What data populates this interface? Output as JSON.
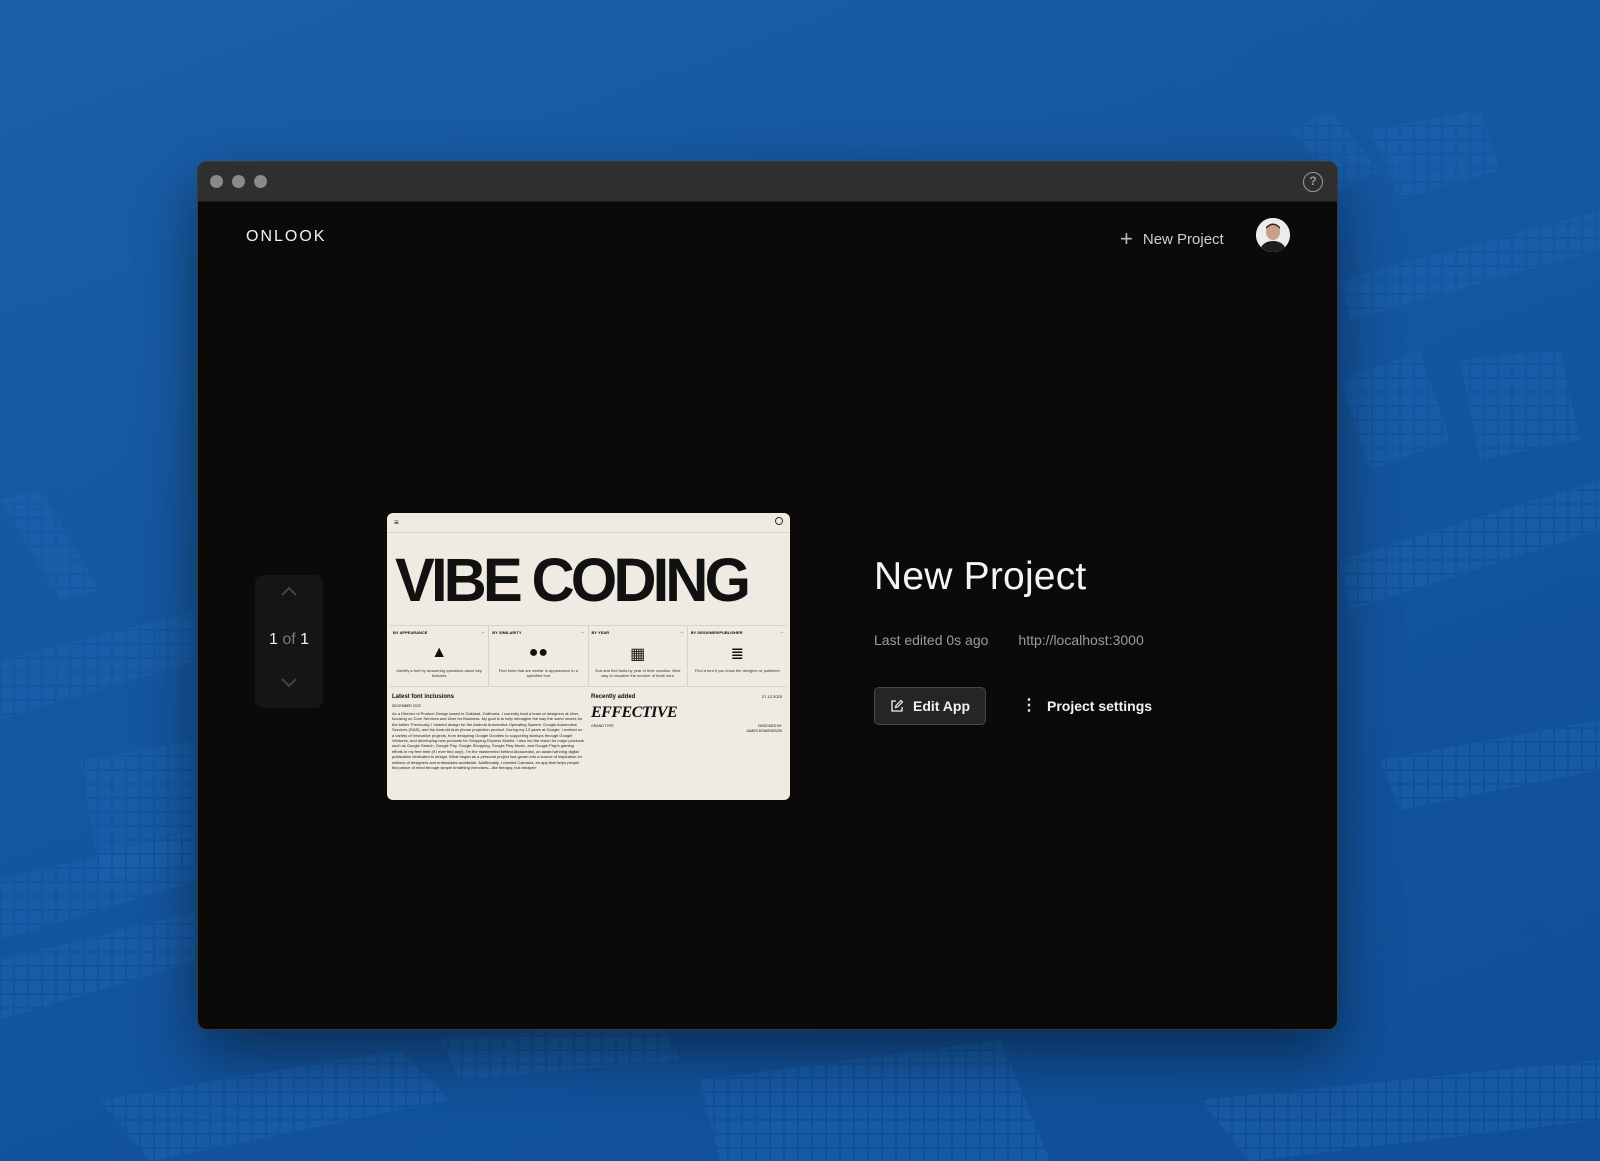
{
  "window": {
    "help_icon": "?"
  },
  "header": {
    "logo": "ONLOOK",
    "new_project_icon": "+",
    "new_project_label": "New Project"
  },
  "pager": {
    "current": "1",
    "of": "of",
    "total": "1"
  },
  "preview": {
    "menu_icon": "≡",
    "headline": "VIBE CODING",
    "categories": [
      {
        "label": "BY APPEARANCE",
        "glyph": "▲",
        "desc": "Identify a font by answering questions about key features"
      },
      {
        "label": "BY SIMILARITY",
        "glyph": "●●",
        "desc": "Find fonts that are similar in appearance to a specified font"
      },
      {
        "label": "BY YEAR",
        "glyph": "▦",
        "desc": "Sort and find fonts by year of their creation. Best way to visualize the number of fonts here"
      },
      {
        "label": "BY DESIGNER/PUBLISHER",
        "glyph": "≣",
        "desc": "Find a font if you know the designer or publisher"
      }
    ],
    "arrow": "→",
    "latest_title": "Latest font inclusions",
    "latest_date": "DECEMBER 2023",
    "latest_body": "As a Director of Product Design based in Oakland, California, I currently lead a team of designers at Uber, focusing on Core Services and Uber for Business. My goal is to help reimagine the way the world moves for the better. Previously, I headed design for the Android Automotive Operating System, Google Automotive Services (GAS), and the Android Auto phone projection product. During my 13 years at Google, I worked on a variety of innovative projects, from designing Google Doodles to supporting startups through Google Ventures, and developing new products for Shopping Express Mobile. I also led the vision for major products such as Google Search, Google Pay, Google Shopping, Google Play Music, and Google Play's gaming efforts in my free time (if I ever find any!). I'm the mastermind behind Abducedan, an award winning digital publication dedicated to design. What began as a personal project has grown into a source of inspiration for millions of designers and enthusiasts worldwide. Additionally, I created Calmaria, an app that helps people find peace of mind through simple breathing exercises—like therapy, but cheaper!",
    "recent_title": "Recently added",
    "recent_date": "27.12.2023",
    "recent_font": "EFFECTIVE",
    "recent_foundry": "GRAND TYPE",
    "recent_designer_label": "DESIGNED BY",
    "recent_designer": "JAMES EDMONDSON"
  },
  "project": {
    "title": "New Project",
    "last_edited": "Last edited 0s ago",
    "url": "http://localhost:3000",
    "edit_button": "Edit App",
    "settings_icon": "⋮",
    "settings_button": "Project settings"
  },
  "colors": {
    "background": "#1456a0",
    "window": "#0b0a09",
    "titlebar": "#2f2f2f",
    "preview_bg": "#efeae2"
  }
}
